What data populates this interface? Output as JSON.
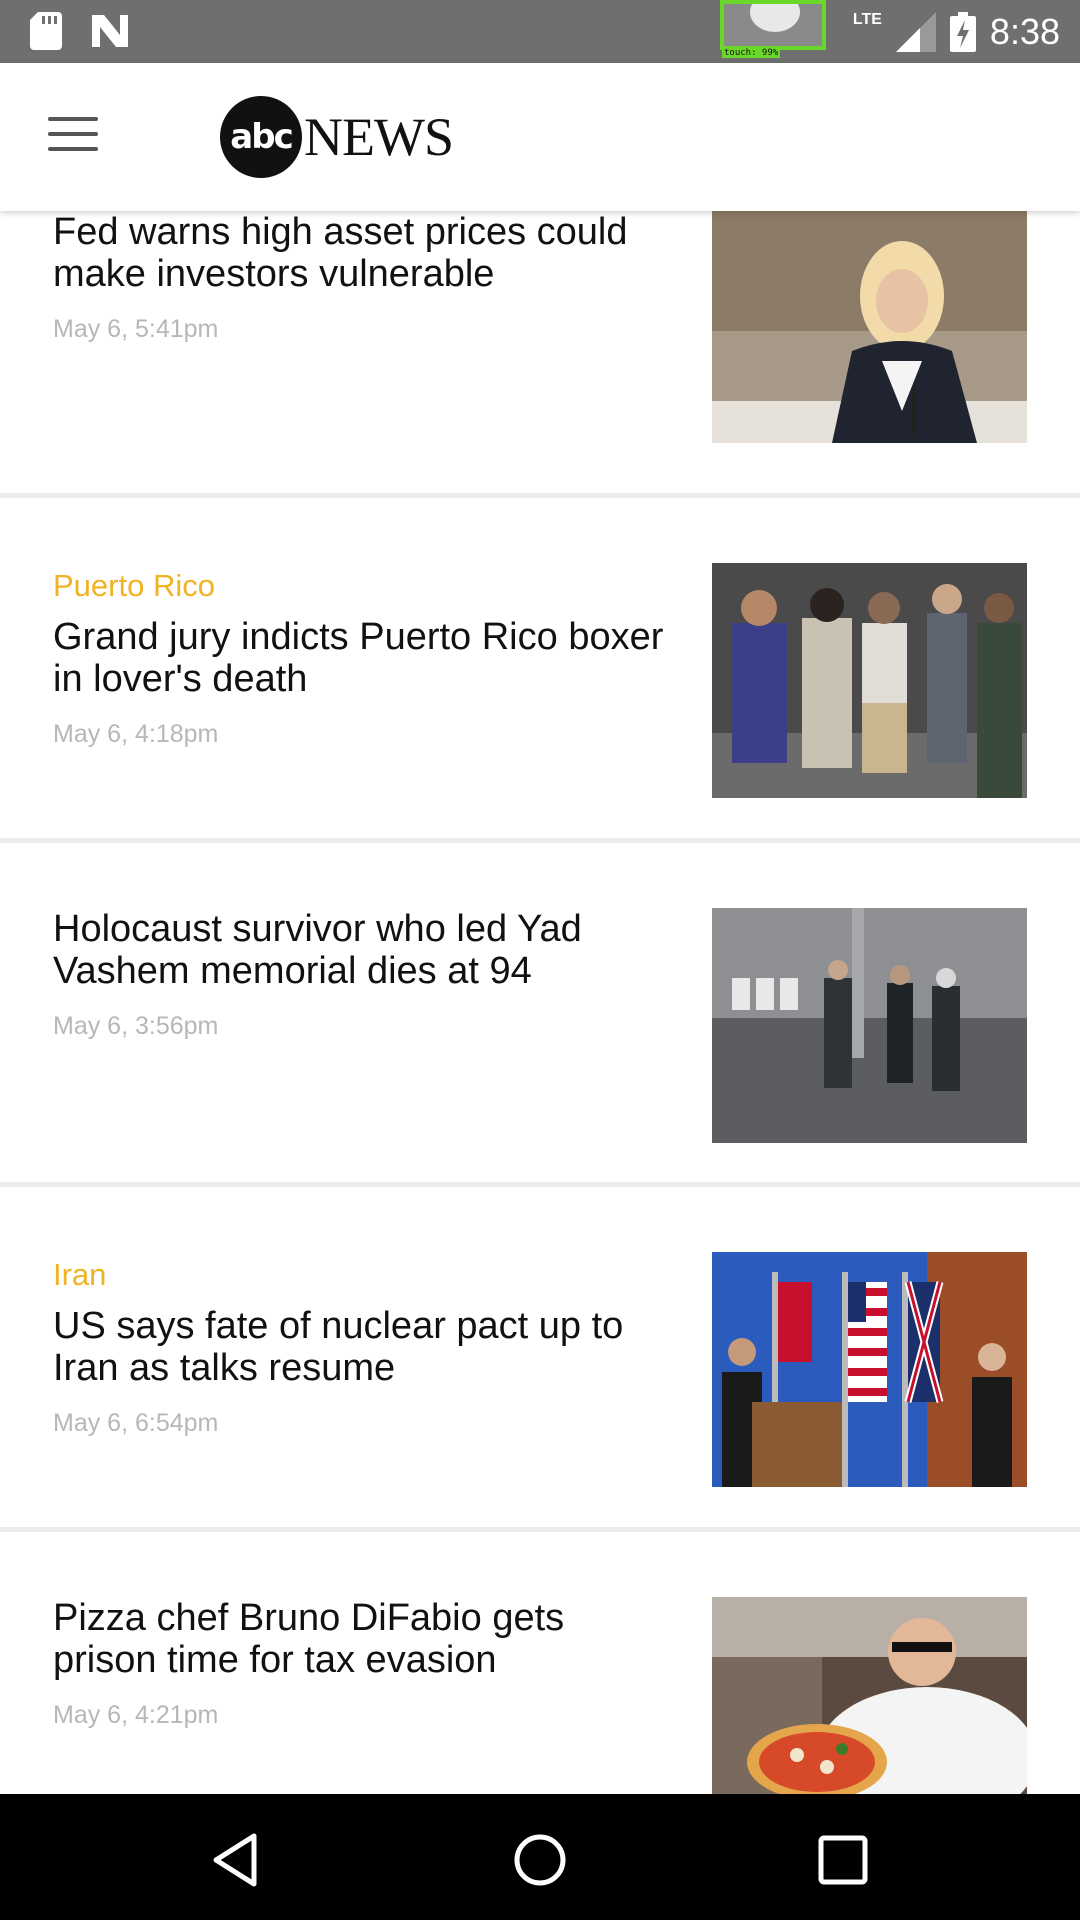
{
  "status_bar": {
    "network": "LTE",
    "time": "8:38",
    "touch_label": "touch: 99%"
  },
  "header": {
    "logo_abc": "abc",
    "logo_news": "NEWS"
  },
  "articles": [
    {
      "category": "",
      "headline": "Fed warns high asset prices could make investors vulnerable",
      "timestamp": "May 6, 5:41pm"
    },
    {
      "category": "Puerto Rico",
      "headline": "Grand jury indicts Puerto Rico boxer in lover's death",
      "timestamp": "May 6, 4:18pm"
    },
    {
      "category": "",
      "headline": "Holocaust survivor who led Yad Vashem memorial dies at 94",
      "timestamp": "May 6, 3:56pm"
    },
    {
      "category": "Iran",
      "headline": "US says fate of nuclear pact up to Iran as talks resume",
      "timestamp": "May 6, 6:54pm"
    },
    {
      "category": "",
      "headline": "Pizza chef Bruno DiFabio gets prison time for tax evasion",
      "timestamp": "May 6, 4:21pm"
    }
  ],
  "colors": {
    "category": "#f0b323",
    "status_bar": "#6f6f6f",
    "nav_bar": "#000000"
  }
}
